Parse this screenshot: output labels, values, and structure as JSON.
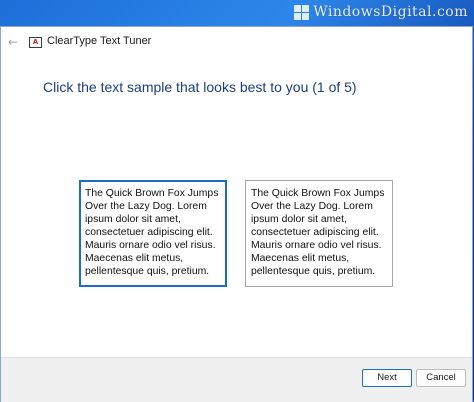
{
  "watermark": {
    "text": "WindowsDigital.com"
  },
  "window": {
    "title": "ClearType Text Tuner",
    "heading": "Click the text sample that looks best to you (1 of 5)"
  },
  "samples": [
    {
      "text": "The Quick Brown Fox Jumps Over the Lazy Dog. Lorem ipsum dolor sit amet, consectetuer adipiscing elit. Mauris ornare odio vel risus. Maecenas elit metus, pellentesque quis, pretium.",
      "selected": true
    },
    {
      "text": "The Quick Brown Fox Jumps Over the Lazy Dog. Lorem ipsum dolor sit amet, consectetuer adipiscing elit. Mauris ornare odio vel risus. Maecenas elit metus, pellentesque quis, pretium.",
      "selected": false
    }
  ],
  "buttons": {
    "next": "Next",
    "cancel": "Cancel"
  },
  "icons": {
    "back": "back-arrow-icon",
    "app": "cleartype-icon",
    "watermark": "windows-logo-icon"
  },
  "colors": {
    "accent": "#1b6ec2",
    "heading": "#1d3e82"
  }
}
